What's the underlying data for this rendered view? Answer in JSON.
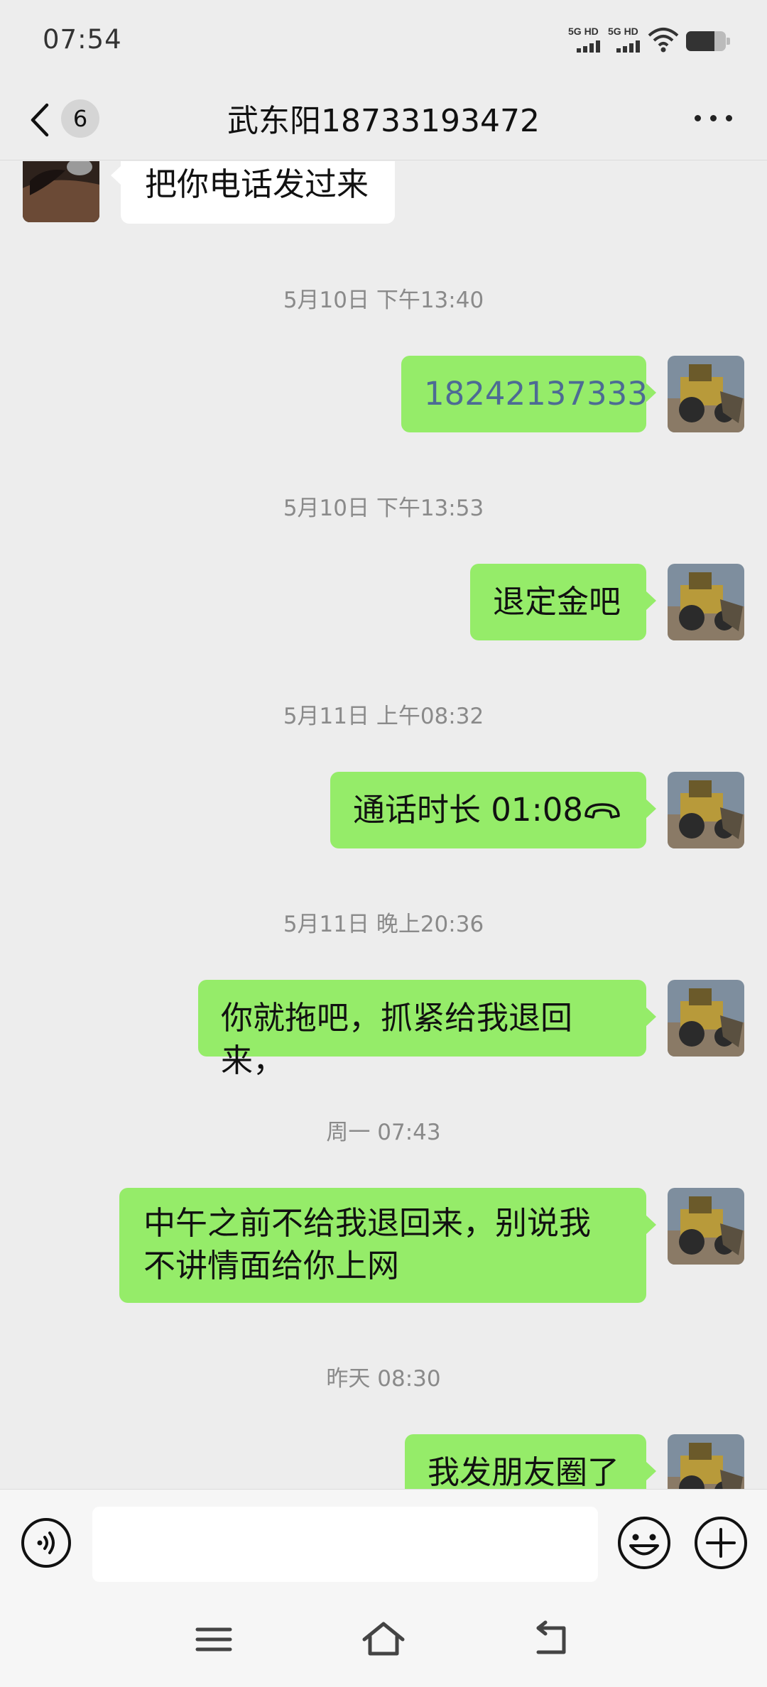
{
  "status_bar": {
    "time": "07:54",
    "sim1": "5G HD",
    "sim2": "5G HD",
    "icons": [
      "signal-icon",
      "signal-icon",
      "wifi-icon",
      "battery-icon"
    ]
  },
  "header": {
    "unread_count": "6",
    "title": "武东阳18733193472",
    "icons": [
      "back-icon",
      "more-icon"
    ]
  },
  "messages": [
    {
      "type": "in",
      "text": "把你电话发过来"
    },
    {
      "type": "time",
      "text": "5月10日 下午13:40"
    },
    {
      "type": "out",
      "text": "18242137333"
    },
    {
      "type": "time",
      "text": "5月10日 下午13:53"
    },
    {
      "type": "out",
      "text": "退定金吧"
    },
    {
      "type": "time",
      "text": "5月11日 上午08:32"
    },
    {
      "type": "call",
      "text": "通话时长 01:08"
    },
    {
      "type": "time",
      "text": "5月11日 晚上20:36"
    },
    {
      "type": "out",
      "text": "你就拖吧，抓紧给我退回来，"
    },
    {
      "type": "time",
      "text": "周一 07:43"
    },
    {
      "type": "out",
      "text": "中午之前不给我退回来，别说我不讲情面给你上网"
    },
    {
      "type": "time",
      "text": "昨天 08:30"
    },
    {
      "type": "out",
      "text": "我发朋友圈了"
    }
  ],
  "input_bar": {
    "placeholder": "",
    "icons": [
      "voice-icon",
      "emoji-icon",
      "plus-icon"
    ]
  },
  "nav_bar": {
    "icons": [
      "menu-icon",
      "home-icon",
      "back-nav-icon"
    ]
  },
  "colors": {
    "background": "#ededed",
    "outgoing_bubble": "#95ec69",
    "incoming_bubble": "#ffffff",
    "phone_link": "#4d6b94"
  }
}
